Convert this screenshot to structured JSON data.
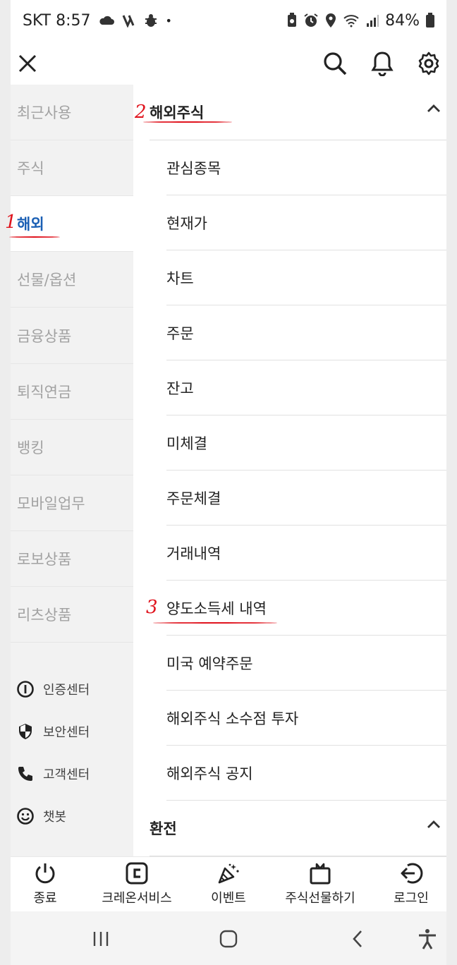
{
  "status_bar": {
    "carrier_time": "SKT 8:57",
    "dot": "•",
    "battery": "84%"
  },
  "header": {
    "close_icon": "close-icon",
    "search_icon": "search-icon",
    "bell_icon": "bell-icon",
    "gear_icon": "gear-icon"
  },
  "left_menu": {
    "items": [
      {
        "label": "최근사용"
      },
      {
        "label": "주식"
      },
      {
        "label": "해외"
      },
      {
        "label": "선물/옵션"
      },
      {
        "label": "금융상품"
      },
      {
        "label": "퇴직연금"
      },
      {
        "label": "뱅킹"
      },
      {
        "label": "모바일업무"
      },
      {
        "label": "로보상품"
      },
      {
        "label": "리츠상품"
      }
    ],
    "active_index": 2,
    "utilities": [
      {
        "label": "인증센터",
        "icon": "cert-icon"
      },
      {
        "label": "보안센터",
        "icon": "shield-icon"
      },
      {
        "label": "고객센터",
        "icon": "phone-icon"
      },
      {
        "label": "챗봇",
        "icon": "smiley-icon"
      }
    ]
  },
  "right_content": {
    "section1_title": "해외주식",
    "items": [
      {
        "label": "관심종목"
      },
      {
        "label": "현재가"
      },
      {
        "label": "차트"
      },
      {
        "label": "주문"
      },
      {
        "label": "잔고"
      },
      {
        "label": "미체결"
      },
      {
        "label": "주문체결"
      },
      {
        "label": "거래내역"
      },
      {
        "label": "양도소득세 내역"
      },
      {
        "label": "미국 예약주문"
      },
      {
        "label": "해외주식 소수점 투자"
      },
      {
        "label": "해외주식 공지"
      }
    ],
    "section2_title": "환전"
  },
  "bottom_bar": {
    "items": [
      {
        "label": "종료",
        "icon": "power-icon"
      },
      {
        "label": "크레온서비스",
        "icon": "creon-icon"
      },
      {
        "label": "이벤트",
        "icon": "party-icon"
      },
      {
        "label": "주식선물하기",
        "icon": "gift-icon"
      },
      {
        "label": "로그인",
        "icon": "login-icon"
      }
    ]
  },
  "annotations": {
    "a1": "1",
    "a2": "2",
    "a3": "3",
    "color": "#e0141e"
  },
  "colors": {
    "accent": "#1a5fb4",
    "inactive_text": "#a2a2a2",
    "left_bg": "#f2f2f2"
  }
}
